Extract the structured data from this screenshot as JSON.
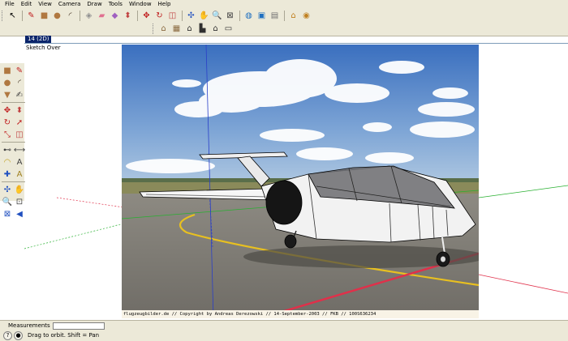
{
  "menu": [
    "File",
    "Edit",
    "View",
    "Camera",
    "Draw",
    "Tools",
    "Window",
    "Help"
  ],
  "toolbar_row1": [
    {
      "name": "select-tool",
      "icon": "arrow-icon",
      "glyph": "↖",
      "color": "#000000"
    },
    {
      "name": "line-tool",
      "icon": "pencil-icon",
      "glyph": "✎",
      "color": "#c02020"
    },
    {
      "name": "rectangle-tool",
      "icon": "rectangle-icon",
      "glyph": "■",
      "color": "#b07840"
    },
    {
      "name": "circle-tool",
      "icon": "circle-icon",
      "glyph": "●",
      "color": "#b07840"
    },
    {
      "name": "arc-tool",
      "icon": "arc-icon",
      "glyph": "◜",
      "color": "#403020"
    },
    {
      "name": "make-component-tool",
      "icon": "component-icon",
      "glyph": "◈",
      "color": "#909090"
    },
    {
      "name": "eraser-tool",
      "icon": "eraser-icon",
      "glyph": "▰",
      "color": "#e07090"
    },
    {
      "name": "paint-bucket-tool",
      "icon": "bucket-icon",
      "glyph": "◆",
      "color": "#a060c0"
    },
    {
      "name": "push-pull-tool",
      "icon": "push-pull-icon",
      "glyph": "⬍",
      "color": "#c04040"
    },
    {
      "name": "move-tool",
      "icon": "move-icon",
      "glyph": "✥",
      "color": "#c02020"
    },
    {
      "name": "rotate-tool",
      "icon": "rotate-icon",
      "glyph": "↻",
      "color": "#c02020"
    },
    {
      "name": "offset-tool",
      "icon": "offset-icon",
      "glyph": "◫",
      "color": "#c04040"
    },
    {
      "name": "orbit-tool",
      "icon": "orbit-icon",
      "glyph": "✣",
      "color": "#2050c0"
    },
    {
      "name": "pan-tool",
      "icon": "hand-icon",
      "glyph": "✋",
      "color": "#404040"
    },
    {
      "name": "zoom-tool",
      "icon": "magnifier-icon",
      "glyph": "🔍",
      "color": "#404040"
    },
    {
      "name": "zoom-extents-tool",
      "icon": "zoom-extents-icon",
      "glyph": "⊠",
      "color": "#404040"
    },
    {
      "name": "get-models-tool",
      "icon": "globe-icon",
      "glyph": "◍",
      "color": "#2070c0"
    },
    {
      "name": "share-model-tool",
      "icon": "share-icon",
      "glyph": "▣",
      "color": "#2070c0"
    },
    {
      "name": "components-tool",
      "icon": "folder-icon",
      "glyph": "▤",
      "color": "#707070"
    },
    {
      "name": "warehouse-tool",
      "icon": "house-icon",
      "glyph": "⌂",
      "color": "#c08020"
    },
    {
      "name": "extension-tool",
      "icon": "extension-icon",
      "glyph": "◉",
      "color": "#c08020"
    }
  ],
  "toolbar_row2": [
    {
      "name": "iso-view-button",
      "icon": "iso-view-icon",
      "glyph": "⌂",
      "color": "#8a6a40"
    },
    {
      "name": "top-view-button",
      "icon": "top-view-icon",
      "glyph": "▦",
      "color": "#8a6a40"
    },
    {
      "name": "front-view-button",
      "icon": "front-view-icon",
      "glyph": "⌂",
      "color": "#303030"
    },
    {
      "name": "right-view-button",
      "icon": "right-view-icon",
      "glyph": "▙",
      "color": "#303030"
    },
    {
      "name": "back-view-button",
      "icon": "back-view-icon",
      "glyph": "⌂",
      "color": "#303030"
    },
    {
      "name": "left-view-button",
      "icon": "left-view-icon",
      "glyph": "▭",
      "color": "#303030"
    }
  ],
  "sidebar_tools": [
    {
      "name": "rectangle",
      "glyph": "■",
      "color": "#b07840"
    },
    {
      "name": "line",
      "glyph": "✎",
      "color": "#c02020"
    },
    {
      "name": "circle",
      "glyph": "●",
      "color": "#b07840"
    },
    {
      "name": "arc",
      "glyph": "◜",
      "color": "#403020"
    },
    {
      "name": "polygon",
      "glyph": "▼",
      "color": "#b07840"
    },
    {
      "name": "freehand",
      "glyph": "✍",
      "color": "#404040"
    },
    {
      "sep": true
    },
    {
      "name": "move",
      "glyph": "✥",
      "color": "#c02020"
    },
    {
      "name": "push-pull",
      "glyph": "⬍",
      "color": "#c04040"
    },
    {
      "name": "rotate",
      "glyph": "↻",
      "color": "#c02020"
    },
    {
      "name": "follow-me",
      "glyph": "➚",
      "color": "#c02020"
    },
    {
      "name": "scale",
      "glyph": "⤡",
      "color": "#c02020"
    },
    {
      "name": "offset",
      "glyph": "◫",
      "color": "#c04040"
    },
    {
      "sep": true
    },
    {
      "name": "tape-measure",
      "glyph": "⊷",
      "color": "#404040"
    },
    {
      "name": "dimension",
      "glyph": "⟷",
      "color": "#404040"
    },
    {
      "name": "protractor",
      "glyph": "◠",
      "color": "#c0a020"
    },
    {
      "name": "text",
      "glyph": "A",
      "color": "#404040"
    },
    {
      "name": "axes",
      "glyph": "✚",
      "color": "#2050c0"
    },
    {
      "name": "3d-text",
      "glyph": "A",
      "color": "#a08020"
    },
    {
      "sep": true
    },
    {
      "name": "orbit",
      "glyph": "✣",
      "color": "#2050c0"
    },
    {
      "name": "pan",
      "glyph": "✋",
      "color": "#404040"
    },
    {
      "name": "zoom",
      "glyph": "🔍",
      "color": "#404040"
    },
    {
      "name": "zoom-window",
      "glyph": "⊡",
      "color": "#404040"
    },
    {
      "name": "zoom-extents",
      "glyph": "⊠",
      "color": "#2050c0"
    },
    {
      "name": "previous-view",
      "glyph": "◀",
      "color": "#2050c0"
    }
  ],
  "scene_tab": "14 (2D)",
  "style_label": "Sketch Over",
  "photo_credit": "flugzeugbilder.de // Copyright by Andreas Derezowski // 14-September-2003 // FKB // 100S636234",
  "measurements_label": "Measurements",
  "measurements_value": "",
  "status": {
    "icon_glyph": "?",
    "hint": "Drag to orbit.  Shift = Pan"
  },
  "colors": {
    "sky_top": "#3a6fbf",
    "sky_bottom": "#a8c4e0",
    "axis_blue": "#2a3fc8",
    "axis_red": "#e0304a",
    "axis_green": "#28b030",
    "runway_yellow": "#e8c020"
  }
}
